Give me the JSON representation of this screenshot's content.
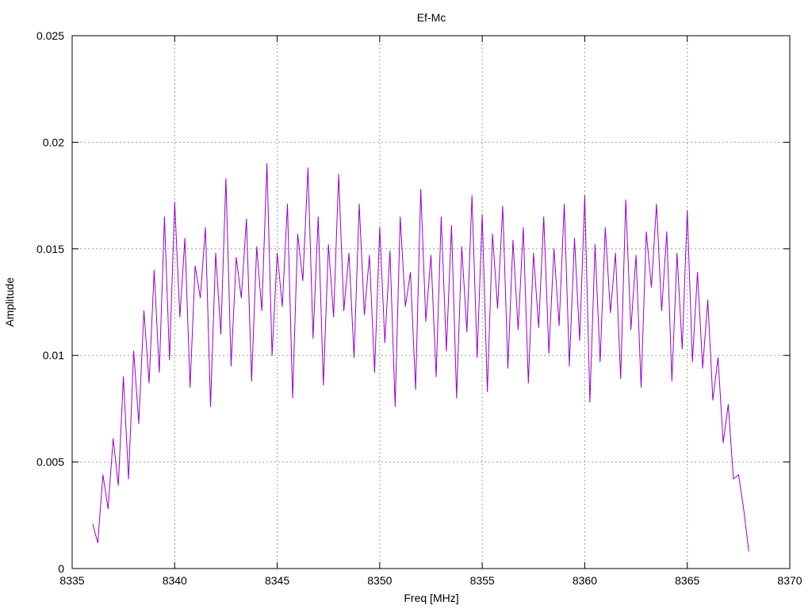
{
  "chart_data": {
    "type": "line",
    "title": "Ef-Mc",
    "xlabel": "Freq [MHz]",
    "ylabel": "Amplitude",
    "xlim": [
      8335,
      8370
    ],
    "ylim": [
      0,
      0.025
    ],
    "x_ticks": [
      "8335",
      "8340",
      "8345",
      "8350",
      "8355",
      "8360",
      "8365",
      "8370"
    ],
    "y_ticks": [
      "0",
      "0.005",
      "0.01",
      "0.015",
      "0.02",
      "0.025"
    ],
    "grid": true,
    "legend": "none",
    "series": [
      {
        "color": "#9400d3",
        "x": [
          8336.0,
          8336.25,
          8336.5,
          8336.75,
          8337.0,
          8337.25,
          8337.5,
          8337.75,
          8338.0,
          8338.25,
          8338.5,
          8338.75,
          8339.0,
          8339.25,
          8339.5,
          8339.75,
          8340.0,
          8340.25,
          8340.5,
          8340.75,
          8341.0,
          8341.25,
          8341.5,
          8341.75,
          8342.0,
          8342.25,
          8342.5,
          8342.75,
          8343.0,
          8343.25,
          8343.5,
          8343.75,
          8344.0,
          8344.25,
          8344.5,
          8344.75,
          8345.0,
          8345.25,
          8345.5,
          8345.75,
          8346.0,
          8346.25,
          8346.5,
          8346.75,
          8347.0,
          8347.25,
          8347.5,
          8347.75,
          8348.0,
          8348.25,
          8348.5,
          8348.75,
          8349.0,
          8349.25,
          8349.5,
          8349.75,
          8350.0,
          8350.25,
          8350.5,
          8350.75,
          8351.0,
          8351.25,
          8351.5,
          8351.75,
          8352.0,
          8352.25,
          8352.5,
          8352.75,
          8353.0,
          8353.25,
          8353.5,
          8353.75,
          8354.0,
          8354.25,
          8354.5,
          8354.75,
          8355.0,
          8355.25,
          8355.5,
          8355.75,
          8356.0,
          8356.25,
          8356.5,
          8356.75,
          8357.0,
          8357.25,
          8357.5,
          8357.75,
          8358.0,
          8358.25,
          8358.5,
          8358.75,
          8359.0,
          8359.25,
          8359.5,
          8359.75,
          8360.0,
          8360.25,
          8360.5,
          8360.75,
          8361.0,
          8361.25,
          8361.5,
          8361.75,
          8362.0,
          8362.25,
          8362.5,
          8362.75,
          8363.0,
          8363.25,
          8363.5,
          8363.75,
          8364.0,
          8364.25,
          8364.5,
          8364.75,
          8365.0,
          8365.25,
          8365.5,
          8365.75,
          8366.0,
          8366.25,
          8366.5,
          8366.75,
          8367.0,
          8367.25,
          8367.5,
          8367.75,
          8368.0
        ],
        "y": [
          0.0021,
          0.0012,
          0.0044,
          0.0028,
          0.0061,
          0.0039,
          0.009,
          0.0042,
          0.0102,
          0.0068,
          0.0121,
          0.0087,
          0.014,
          0.0092,
          0.0165,
          0.0098,
          0.0172,
          0.0118,
          0.0155,
          0.0085,
          0.0142,
          0.0127,
          0.016,
          0.0076,
          0.0148,
          0.011,
          0.0183,
          0.0095,
          0.0146,
          0.0127,
          0.0164,
          0.0088,
          0.0151,
          0.0121,
          0.019,
          0.01,
          0.0148,
          0.0123,
          0.0171,
          0.008,
          0.0157,
          0.0135,
          0.0188,
          0.0108,
          0.0165,
          0.0086,
          0.0152,
          0.0118,
          0.0185,
          0.0121,
          0.0148,
          0.0099,
          0.0171,
          0.0119,
          0.0147,
          0.0092,
          0.016,
          0.0106,
          0.0149,
          0.0076,
          0.0165,
          0.0123,
          0.0139,
          0.0084,
          0.0178,
          0.0116,
          0.0147,
          0.009,
          0.0165,
          0.0102,
          0.0161,
          0.008,
          0.0151,
          0.0111,
          0.0175,
          0.0099,
          0.0166,
          0.0083,
          0.0157,
          0.0122,
          0.017,
          0.0094,
          0.0154,
          0.0112,
          0.016,
          0.0087,
          0.0148,
          0.0113,
          0.0165,
          0.0101,
          0.015,
          0.0114,
          0.0171,
          0.0095,
          0.0155,
          0.0107,
          0.0175,
          0.0078,
          0.0152,
          0.0097,
          0.016,
          0.012,
          0.0148,
          0.0089,
          0.0173,
          0.0112,
          0.0147,
          0.0085,
          0.0158,
          0.0132,
          0.0171,
          0.0121,
          0.0158,
          0.0088,
          0.0148,
          0.0103,
          0.0168,
          0.0097,
          0.0139,
          0.0094,
          0.0126,
          0.0079,
          0.0099,
          0.0059,
          0.0077,
          0.0042,
          0.0044,
          0.0028,
          0.0008
        ]
      }
    ]
  }
}
